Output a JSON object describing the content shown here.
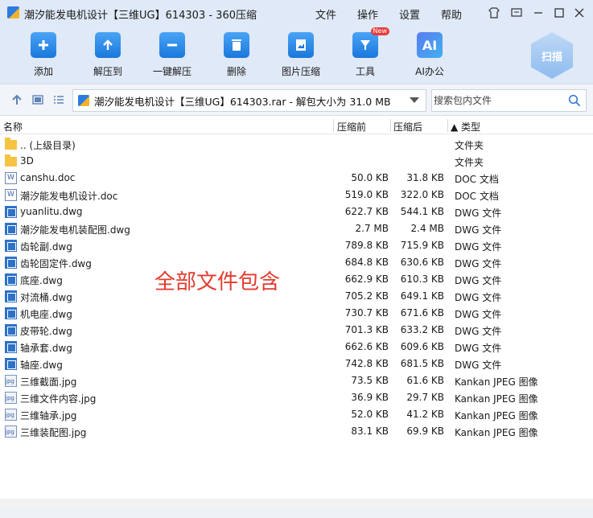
{
  "window": {
    "title": "潮汐能发电机设计【三维UG】614303 - 360压缩",
    "menus": [
      "文件",
      "操作",
      "设置",
      "帮助"
    ]
  },
  "toolbar": {
    "items": [
      {
        "label": "添加",
        "icon": "add-icon"
      },
      {
        "label": "解压到",
        "icon": "extract-icon"
      },
      {
        "label": "一键解压",
        "icon": "one-click-extract-icon"
      },
      {
        "label": "删除",
        "icon": "delete-icon"
      },
      {
        "label": "图片压缩",
        "icon": "image-compress-icon"
      },
      {
        "label": "工具",
        "icon": "tools-icon",
        "badge": "New"
      },
      {
        "label": "AI办公",
        "icon": "ai-office-icon",
        "glyph": "AI"
      }
    ],
    "scan_label": "扫描"
  },
  "address": {
    "path": "潮汐能发电机设计【三维UG】614303.rar - 解包大小为 31.0 MB",
    "search_placeholder": "搜索包内文件"
  },
  "columns": {
    "name": "名称",
    "packed": "压缩前",
    "compressed": "压缩后",
    "type": "▲ 类型"
  },
  "files": [
    {
      "name": ".. (上级目录)",
      "packed": "",
      "compressed": "",
      "type": "文件夹",
      "kind": "folder"
    },
    {
      "name": "3D",
      "packed": "",
      "compressed": "",
      "type": "文件夹",
      "kind": "folder"
    },
    {
      "name": "canshu.doc",
      "packed": "50.0 KB",
      "compressed": "31.8 KB",
      "type": "DOC 文档",
      "kind": "doc"
    },
    {
      "name": "潮汐能发电机设计.doc",
      "packed": "519.0 KB",
      "compressed": "322.0 KB",
      "type": "DOC 文档",
      "kind": "doc"
    },
    {
      "name": "yuanlitu.dwg",
      "packed": "622.7 KB",
      "compressed": "544.1 KB",
      "type": "DWG 文件",
      "kind": "dwg"
    },
    {
      "name": "潮汐能发电机装配图.dwg",
      "packed": "2.7 MB",
      "compressed": "2.4 MB",
      "type": "DWG 文件",
      "kind": "dwg"
    },
    {
      "name": "齿轮副.dwg",
      "packed": "789.8 KB",
      "compressed": "715.9 KB",
      "type": "DWG 文件",
      "kind": "dwg"
    },
    {
      "name": "齿轮固定件.dwg",
      "packed": "684.8 KB",
      "compressed": "630.6 KB",
      "type": "DWG 文件",
      "kind": "dwg"
    },
    {
      "name": "底座.dwg",
      "packed": "662.9 KB",
      "compressed": "610.3 KB",
      "type": "DWG 文件",
      "kind": "dwg"
    },
    {
      "name": "对流桶.dwg",
      "packed": "705.2 KB",
      "compressed": "649.1 KB",
      "type": "DWG 文件",
      "kind": "dwg"
    },
    {
      "name": "机电座.dwg",
      "packed": "730.7 KB",
      "compressed": "671.6 KB",
      "type": "DWG 文件",
      "kind": "dwg"
    },
    {
      "name": "皮带轮.dwg",
      "packed": "701.3 KB",
      "compressed": "633.2 KB",
      "type": "DWG 文件",
      "kind": "dwg"
    },
    {
      "name": "轴承套.dwg",
      "packed": "662.6 KB",
      "compressed": "609.6 KB",
      "type": "DWG 文件",
      "kind": "dwg"
    },
    {
      "name": "轴座.dwg",
      "packed": "742.8 KB",
      "compressed": "681.5 KB",
      "type": "DWG 文件",
      "kind": "dwg"
    },
    {
      "name": "三维截面.jpg",
      "packed": "73.5 KB",
      "compressed": "61.6 KB",
      "type": "Kankan JPEG 图像",
      "kind": "jpg"
    },
    {
      "name": "三维文件内容.jpg",
      "packed": "36.9 KB",
      "compressed": "29.7 KB",
      "type": "Kankan JPEG 图像",
      "kind": "jpg"
    },
    {
      "name": "三维轴承.jpg",
      "packed": "52.0 KB",
      "compressed": "41.2 KB",
      "type": "Kankan JPEG 图像",
      "kind": "jpg"
    },
    {
      "name": "三维装配图.jpg",
      "packed": "83.1 KB",
      "compressed": "69.9 KB",
      "type": "Kankan JPEG 图像",
      "kind": "jpg"
    }
  ],
  "overlay_text": "全部文件包含",
  "colors": {
    "chrome": "#dfe9f7",
    "accent": "#1a78dc",
    "overlay": "#e23b2e",
    "badge": "#ea3b3b"
  }
}
